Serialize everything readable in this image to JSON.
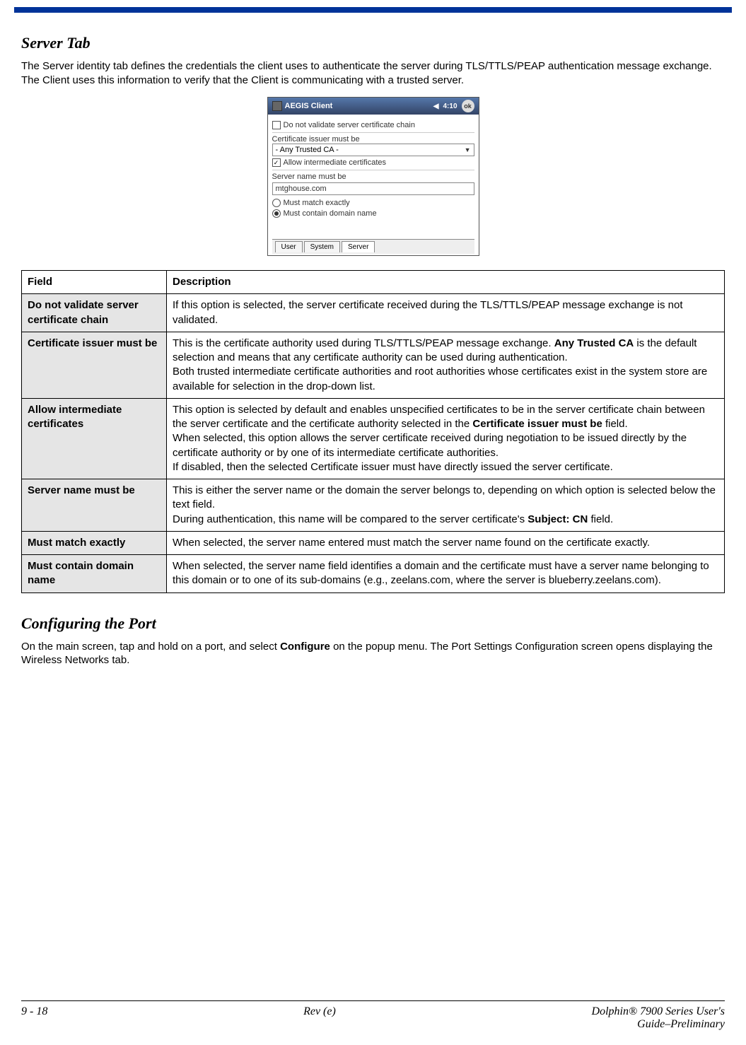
{
  "headings": {
    "server_tab": "Server Tab",
    "configuring_port": "Configuring the Port"
  },
  "paragraphs": {
    "server_tab_intro": "The Server identity tab defines the credentials the client uses to authenticate the server during TLS/TTLS/PEAP authentication message exchange. The Client uses this information to verify that the Client is communicating with a trusted server.",
    "configuring_port_p1a": "On the main screen, tap and hold on a port, and select ",
    "configuring_port_p1_bold": "Configure",
    "configuring_port_p1b": " on the popup menu. The Port Settings Configuration screen opens displaying the Wireless Networks tab."
  },
  "mock": {
    "title": "AEGIS Client",
    "time": "4:10",
    "ok": "ok",
    "chk_novalidate_label": "Do not validate server certificate chain",
    "lbl_cert_issuer": "Certificate issuer must be",
    "sel_any_trusted": "- Any Trusted CA -",
    "chk_allow_intermediate_label": "Allow intermediate certificates",
    "chk_allow_intermediate_check": "✓",
    "lbl_server_name": "Server name must be",
    "input_server_name": "mtghouse.com",
    "radio_must_match": "Must match exactly",
    "radio_must_contain": "Must contain domain name",
    "tabs": {
      "user": "User",
      "system": "System",
      "server": "Server"
    }
  },
  "table": {
    "header": {
      "field": "Field",
      "description": "Description"
    },
    "rows": [
      {
        "field": "Do not validate server certificate chain",
        "desc_parts": [
          {
            "text": "If this option is selected, the server certificate received during the TLS/TTLS/PEAP message exchange is not validated.",
            "bold": false
          }
        ]
      },
      {
        "field": "Certificate issuer must be",
        "desc_parts": [
          {
            "text": "This is the certificate authority used during TLS/TTLS/PEAP message exchange. ",
            "bold": false
          },
          {
            "text": "Any Trusted CA",
            "bold": true
          },
          {
            "text": " is the default selection and means that any certificate authority can be used during authentication.\nBoth trusted intermediate certificate authorities and root authorities whose certificates exist in the system store are available for selection in the drop-down list.",
            "bold": false
          }
        ]
      },
      {
        "field": "Allow intermediate certificates",
        "desc_parts": [
          {
            "text": "This option is selected by default and enables unspecified certificates to be in the server certificate chain between the server certificate and the certificate authority selected in the ",
            "bold": false
          },
          {
            "text": "Certificate issuer must be",
            "bold": true
          },
          {
            "text": " field.\nWhen selected, this option allows the server certificate received during negotiation to be issued directly by the certificate authority or by one of its intermediate certificate authorities.\nIf disabled, then the selected Certificate issuer must have directly issued the server certificate.",
            "bold": false
          }
        ]
      },
      {
        "field": "Server name must be",
        "desc_parts": [
          {
            "text": "This is either the server name or the domain the server belongs to, depending on which option is selected below the text field.\nDuring authentication, this name will be compared to the server certificate's ",
            "bold": false
          },
          {
            "text": "Subject: CN",
            "bold": true
          },
          {
            "text": " field.",
            "bold": false
          }
        ]
      },
      {
        "field": "Must match exactly",
        "desc_parts": [
          {
            "text": "When selected, the server name entered must match the server name found on the certificate exactly.",
            "bold": false
          }
        ]
      },
      {
        "field": "Must contain domain name",
        "desc_parts": [
          {
            "text": "When selected, the server name field identifies a domain and the certificate must have a server name belonging to this domain or to one of its sub-domains (e.g., zeelans.com, where the server is blueberry.zeelans.com).",
            "bold": false
          }
        ]
      }
    ]
  },
  "footer": {
    "page": "9 - 18",
    "rev": "Rev (e)",
    "title_line1": "Dolphin® 7900 Series User's",
    "title_line2": "Guide–Preliminary"
  }
}
